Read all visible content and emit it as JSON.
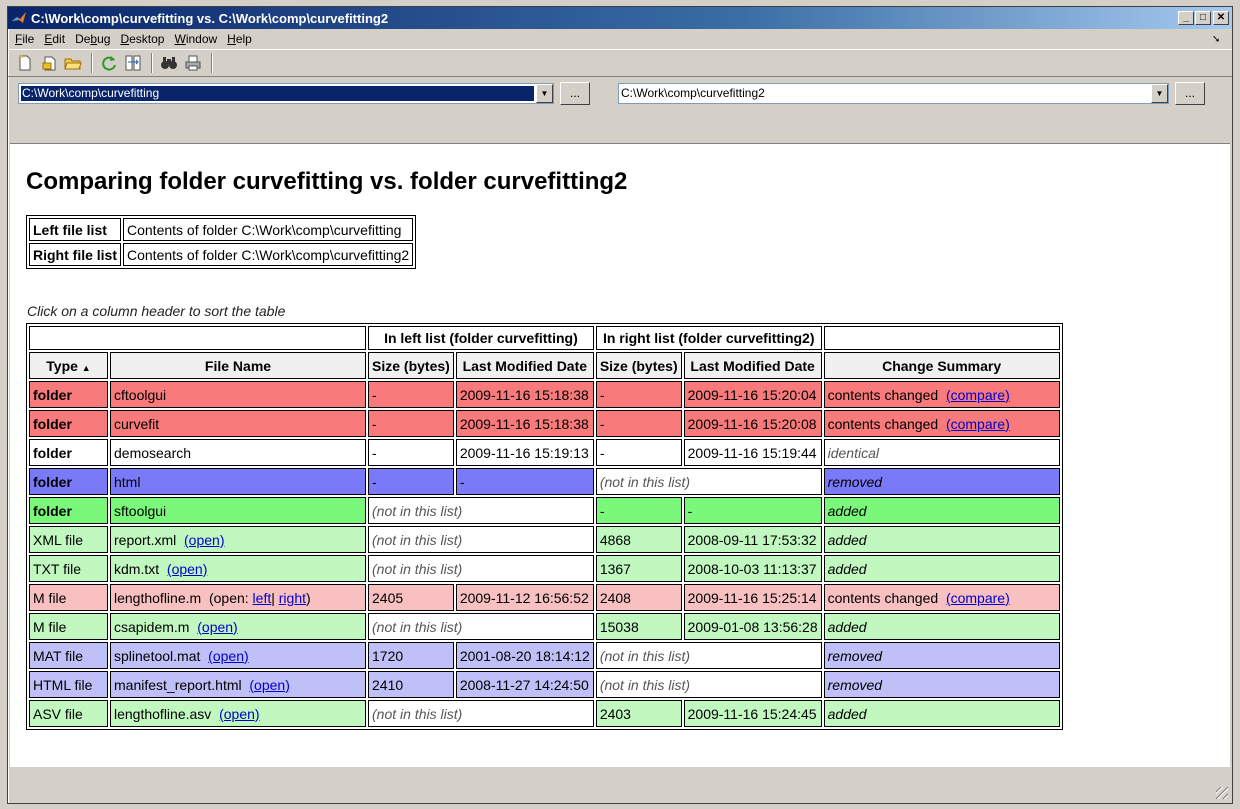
{
  "window": {
    "title": "C:\\Work\\comp\\curvefitting vs. C:\\Work\\comp\\curvefitting2"
  },
  "menu": [
    {
      "label": "File",
      "u": "F",
      "rest": "ile"
    },
    {
      "label": "Edit",
      "u": "E",
      "rest": "dit"
    },
    {
      "label": "Debug",
      "u": "",
      "pre": "De",
      "mid": "b",
      "post": "ug"
    },
    {
      "label": "Desktop",
      "u": "D",
      "rest": "esktop"
    },
    {
      "label": "Window",
      "u": "W",
      "rest": "indow"
    },
    {
      "label": "Help",
      "u": "H",
      "rest": "elp"
    }
  ],
  "paths": {
    "left": "C:\\Work\\comp\\curvefitting",
    "right": "C:\\Work\\comp\\curvefitting2",
    "browse": "..."
  },
  "heading": "Comparing folder curvefitting vs. folder curvefitting2",
  "info": [
    {
      "key": "Left file list",
      "val": "Contents of  folder  C:\\Work\\comp\\curvefitting"
    },
    {
      "key": "Right file list",
      "val": "Contents of  folder  C:\\Work\\comp\\curvefitting2"
    }
  ],
  "hint": "Click on a column header to sort the table",
  "groups": {
    "left": "In left list  (folder curvefitting)",
    "right": "In right list  (folder curvefitting2)"
  },
  "headers": {
    "type": "Type",
    "sort_indicator": "▲",
    "name": "File Name",
    "size": "Size (bytes)",
    "date": "Last Modified Date",
    "summary": "Change Summary"
  },
  "rows": [
    {
      "type": "folder",
      "name": "cftoolgui",
      "lsize": "-",
      "ldate": "2009-11-16 15:18:38",
      "rsize": "-",
      "rdate": "2009-11-16 15:20:04",
      "summary": "contents changed",
      "link": "(compare)"
    },
    {
      "type": "folder",
      "name": "curvefit",
      "lsize": "-",
      "ldate": "2009-11-16 15:18:38",
      "rsize": "-",
      "rdate": "2009-11-16 15:20:08",
      "summary": "contents changed",
      "link": "(compare)"
    },
    {
      "type": "folder",
      "name": "demosearch",
      "lsize": "-",
      "ldate": "2009-11-16 15:19:13",
      "rsize": "-",
      "rdate": "2009-11-16 15:19:44",
      "summary": "identical"
    },
    {
      "type": "folder",
      "name": "html",
      "lsize": "-",
      "ldate": "-",
      "rnot": "(not in this list)",
      "summary": "removed"
    },
    {
      "type": "folder",
      "name": "sftoolgui",
      "lnot": "(not in this list)",
      "rsize": "-",
      "rdate": "-",
      "summary": "added"
    },
    {
      "type": "XML file",
      "name": "report.xml",
      "open": "(open)",
      "lnot": "(not in this list)",
      "rsize": "4868",
      "rdate": "2008-09-11 17:53:32",
      "summary": "added"
    },
    {
      "type": "TXT file",
      "name": "kdm.txt",
      "open": "(open)",
      "lnot": "(not in this list)",
      "rsize": "1367",
      "rdate": "2008-10-03 11:13:37",
      "summary": "added"
    },
    {
      "type": "M file",
      "name": "lengthofline.m",
      "open_pre": "(open:",
      "open_left": "left",
      "open_sep": "|",
      "open_right": "right",
      "open_post": ")",
      "lsize": "2405",
      "ldate": "2009-11-12 16:56:52",
      "rsize": "2408",
      "rdate": "2009-11-16 15:25:14",
      "summary": "contents changed",
      "link": "(compare)"
    },
    {
      "type": "M file",
      "name": "csapidem.m",
      "open": "(open)",
      "lnot": "(not in this list)",
      "rsize": "15038",
      "rdate": "2009-01-08 13:56:28",
      "summary": "added"
    },
    {
      "type": "MAT file",
      "name": "splinetool.mat",
      "open": "(open)",
      "lsize": "1720",
      "ldate": "2001-08-20 18:14:12",
      "rnot": "(not in this list)",
      "summary": "removed"
    },
    {
      "type": "HTML file",
      "name": "manifest_report.html",
      "open": "(open)",
      "lsize": "2410",
      "ldate": "2008-11-27 14:24:50",
      "rnot": "(not in this list)",
      "summary": "removed"
    },
    {
      "type": "ASV file",
      "name": "lengthofline.asv",
      "open": "(open)",
      "lnot": "(not in this list)",
      "rsize": "2403",
      "rdate": "2009-11-16 15:24:45",
      "summary": "added"
    }
  ],
  "colors": {
    "changed": "#f87a7a",
    "removed": "#7a7af8",
    "added": "#7af87a",
    "added_light": "#c0f8c0",
    "changed_light": "#f8c0c0",
    "removed_light": "#c0c0f8"
  }
}
